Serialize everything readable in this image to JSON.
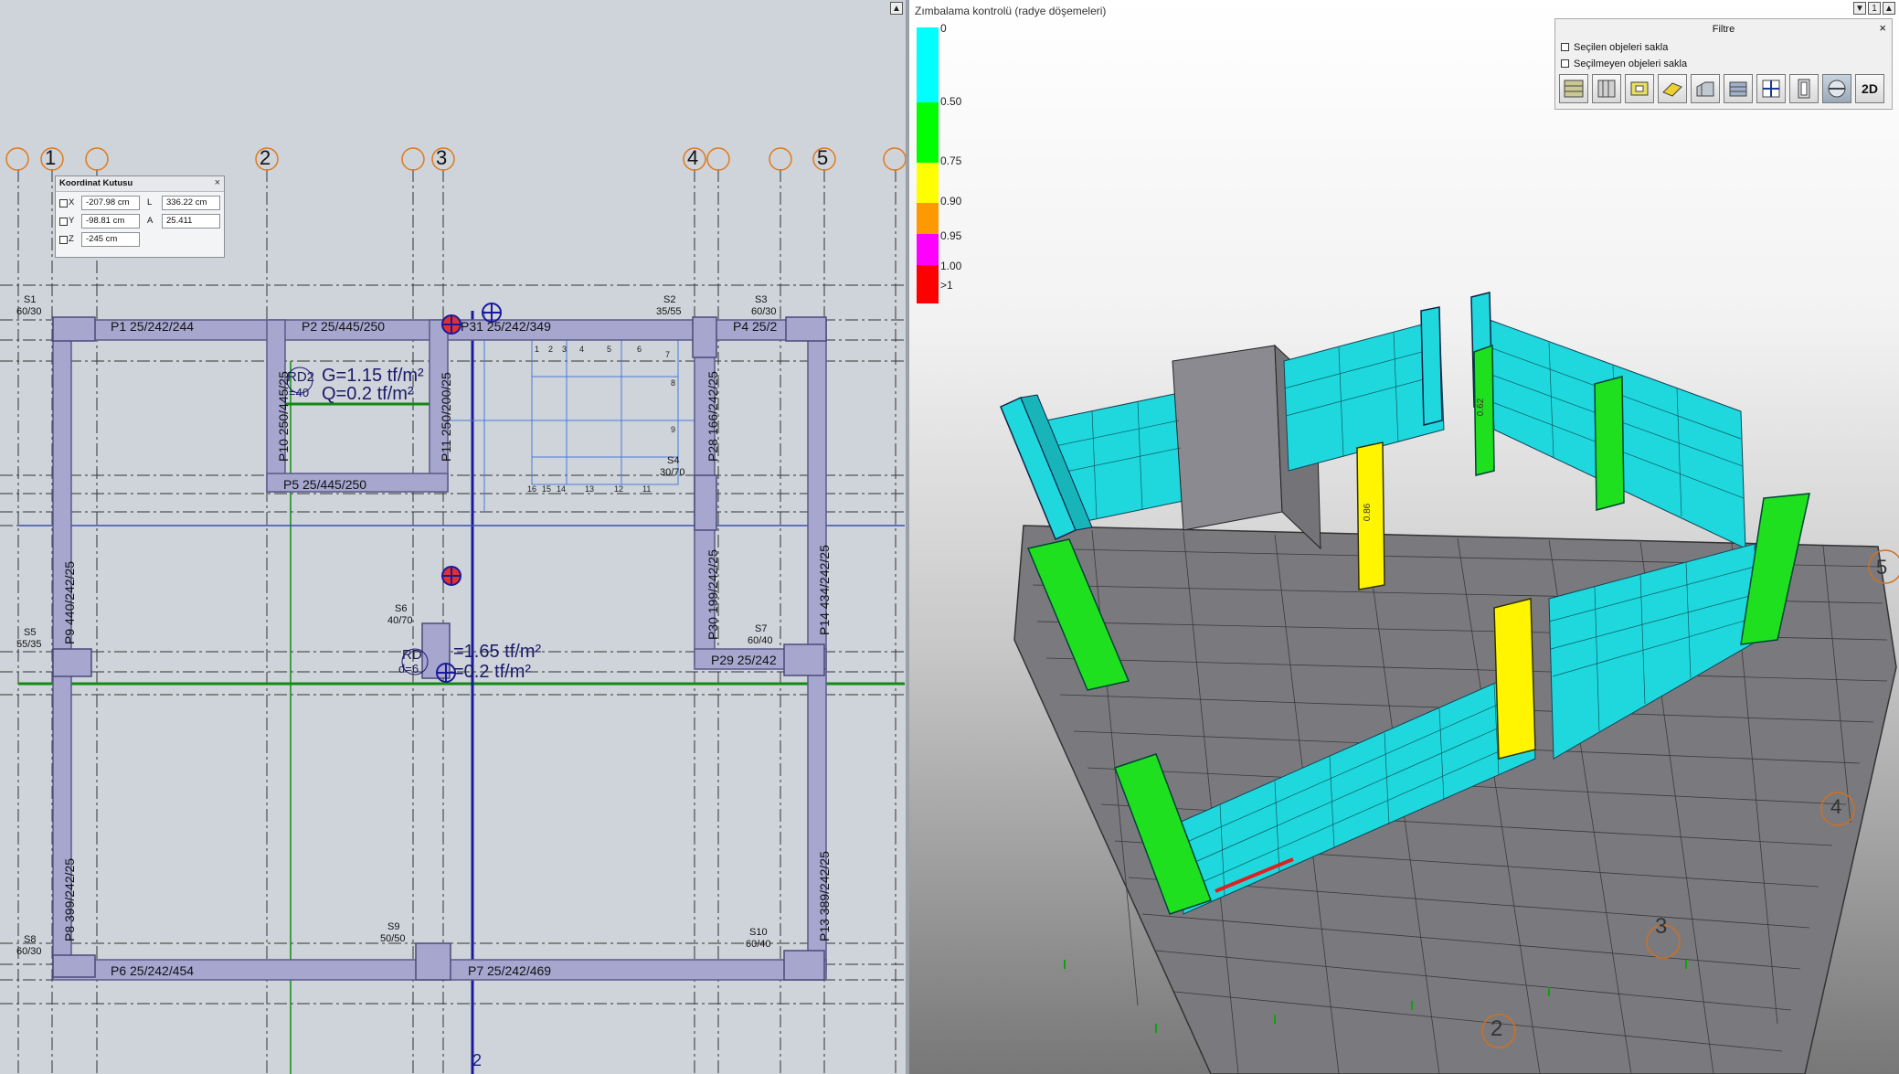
{
  "plan": {
    "axes": [
      "1",
      "2",
      "3",
      "4",
      "5",
      "2"
    ],
    "coord_box": {
      "title": "Koordinat Kutusu",
      "close_glyph": "×",
      "x_label": "X",
      "x_value": "-207.98 cm",
      "y_label": "Y",
      "y_value": "-98.81 cm",
      "z_label": "Z",
      "z_value": "-245 cm",
      "l_label": "L",
      "l_value": "336.22 cm",
      "a_label": "A",
      "a_value": "25.411"
    },
    "columns": [
      {
        "name": "S1",
        "size": "60/30"
      },
      {
        "name": "S2",
        "size": "35/55"
      },
      {
        "name": "S3",
        "size": "60/30"
      },
      {
        "name": "S4",
        "size": "30/70"
      },
      {
        "name": "S5",
        "size": "55/35"
      },
      {
        "name": "S6",
        "size": "40/70"
      },
      {
        "name": "S7",
        "size": "60/40"
      },
      {
        "name": "S8",
        "size": "60/30"
      },
      {
        "name": "S9",
        "size": "50/50"
      },
      {
        "name": "S10",
        "size": "60/40"
      }
    ],
    "walls": [
      "P1 25/242/244",
      "P2 25/445/250",
      "P31 25/242/349",
      "P4 25/2",
      "P5 25/445/250",
      "P6 25/242/454",
      "P7 25/242/469",
      "P29 25/242",
      "P10 250/445/25",
      "P11 250/200/25",
      "P28 166/242/25",
      "P9 440/242/25",
      "P30 199/242/25",
      "P14 434/242/25",
      "P8 399/242/25",
      "P13 389/242/25"
    ],
    "slab1": {
      "name": "RD2",
      "thickness": "=40",
      "g": "G=1.15 tf/m²",
      "q": "Q=0.2 tf/m²"
    },
    "slab2": {
      "name": "RD",
      "thickness": "d=6",
      "g": "=1.65 tf/m²",
      "q": "=0.2 tf/m²"
    },
    "stair_numbers": [
      "1",
      "2",
      "3",
      "4",
      "5",
      "6",
      "7",
      "8",
      "9",
      "16",
      "15",
      "14",
      "13",
      "12",
      "11"
    ]
  },
  "view3d": {
    "title": "Zımbalama kontrolü (radye döşemeleri)",
    "legend": [
      {
        "label": "0",
        "color": "#00ffff"
      },
      {
        "label": "0.50",
        "color": "#00ff00"
      },
      {
        "label": "0.75",
        "color": "#ffff00"
      },
      {
        "label": "0.90",
        "color": "#ff9900"
      },
      {
        "label": "0.95",
        "color": "#ff00ff"
      },
      {
        "label": "1.00",
        "color": "#ff0000"
      },
      {
        "label": ">1",
        "color": ""
      }
    ],
    "filter": {
      "title": "Filtre",
      "close_glyph": "×",
      "opt1": "Seçilen objeleri sakla",
      "opt2": "Seçilmeyen objeleri sakla",
      "btn_2d": "2D"
    },
    "corner_label": "1",
    "column_values": [
      "0.86",
      "0.62"
    ],
    "grid_labels": [
      "2",
      "3",
      "4",
      "5"
    ]
  },
  "icons": [
    "triangle-up-icon",
    "filter-icon"
  ],
  "colors": {
    "wall": "#a6a6cf",
    "wall_stroke": "#5a5a8a",
    "grid": "#2a2a2a",
    "axis_circle": "#e07a1a",
    "cyan": "#00ffff",
    "green": "#00e000",
    "yellow": "#ffff00"
  }
}
